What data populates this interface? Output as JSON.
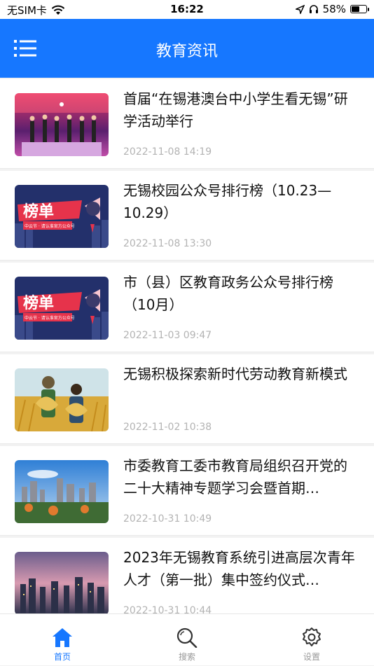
{
  "status": {
    "carrier": "无SIM卡",
    "time": "16:22",
    "battery": "58%",
    "battery_level": 0.58
  },
  "navbar": {
    "title": "教育资讯",
    "menu_icon": "list-menu-icon"
  },
  "news": [
    {
      "title": "首届“在锡港澳台中小学生看无锡”研学活动举行",
      "date": "2022-11-08 14:19",
      "thumb": "stage-event"
    },
    {
      "title": "无锡校园公众号排行榜（10.23—10.29）",
      "date": "2022-11-08 13:30",
      "thumb": "ranking-banner",
      "thumb_text": "榜单",
      "thumb_sub": "中云节 · 请认准官方公众号"
    },
    {
      "title": "市（县）区教育政务公众号排行榜（10月）",
      "date": "2022-11-03 09:47",
      "thumb": "ranking-banner",
      "thumb_text": "榜单",
      "thumb_sub": "中云节 · 请认准官方公众号"
    },
    {
      "title": "无锡积极探索新时代劳动教育新模式",
      "date": "2022-11-02 10:38",
      "thumb": "wheat-field"
    },
    {
      "title": "市委教育工委市教育局组织召开党的二十大精神专题学习会暨首期…",
      "date": "2022-10-31 10:49",
      "thumb": "city-skyline"
    },
    {
      "title": "2023年无锡教育系统引进高层次青年人才（第一批）集中签约仪式…",
      "date": "2022-10-31 10:44",
      "thumb": "city-dusk"
    }
  ],
  "tabs": [
    {
      "label": "首页",
      "icon": "home-icon",
      "active": true
    },
    {
      "label": "搜索",
      "icon": "search-icon",
      "active": false
    },
    {
      "label": "设置",
      "icon": "gear-icon",
      "active": false
    }
  ],
  "colors": {
    "accent": "#1677ff",
    "date": "#b3b3b3",
    "background": "#f2f2f2"
  }
}
